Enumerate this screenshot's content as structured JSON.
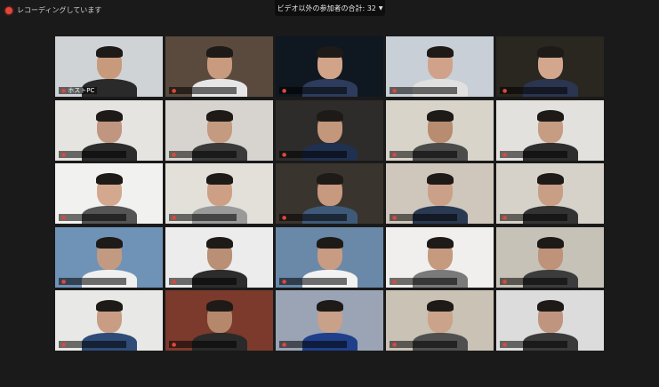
{
  "recording": {
    "label": "レコーディングしています"
  },
  "header": {
    "participants_label": "ビデオ以外の参加者の合計: 32"
  },
  "tiles": [
    {
      "wall": "#cfd3d6",
      "shirt": "#2a2a2a",
      "skin": "#c79a7c",
      "name": "ホストPC",
      "active": false
    },
    {
      "wall": "#5a4a3d",
      "shirt": "#e6e6e6",
      "skin": "#c89a7e",
      "name": "",
      "active": false
    },
    {
      "wall": "#0f1720",
      "shirt": "#2d3c5c",
      "skin": "#d1a48a",
      "name": "",
      "active": false
    },
    {
      "wall": "#c8cfd6",
      "shirt": "#e0e0e0",
      "skin": "#d0a28a",
      "name": "",
      "active": true
    },
    {
      "wall": "#2a2620",
      "shirt": "#2b3550",
      "skin": "#d2a78d",
      "name": "",
      "active": false
    },
    {
      "wall": "#e5e4e0",
      "shirt": "#2c2c2c",
      "skin": "#c09680",
      "name": "",
      "active": false
    },
    {
      "wall": "#d7d4cf",
      "shirt": "#3a3a3a",
      "skin": "#c49a80",
      "name": "",
      "active": false
    },
    {
      "wall": "#2e2c2a",
      "shirt": "#203050",
      "skin": "#c2977c",
      "name": "",
      "active": false
    },
    {
      "wall": "#d9d4c9",
      "shirt": "#4b4b4b",
      "skin": "#b88c70",
      "name": "",
      "active": false
    },
    {
      "wall": "#e2e1dd",
      "shirt": "#2e2e2e",
      "skin": "#c69c82",
      "name": "",
      "active": false
    },
    {
      "wall": "#f1f1ef",
      "shirt": "#555555",
      "skin": "#d4a88e",
      "name": "",
      "active": false
    },
    {
      "wall": "#e3e0da",
      "shirt": "#9a9a9a",
      "skin": "#cda086",
      "name": "",
      "active": false
    },
    {
      "wall": "#3a342e",
      "shirt": "#3f5a78",
      "skin": "#c7997f",
      "name": "",
      "active": false
    },
    {
      "wall": "#cfc7bb",
      "shirt": "#2a3a52",
      "skin": "#caa088",
      "name": "",
      "active": false
    },
    {
      "wall": "#d6d2ca",
      "shirt": "#333333",
      "skin": "#c89e84",
      "name": "",
      "active": false
    },
    {
      "wall": "#6f93b6",
      "shirt": "#f0f0f0",
      "skin": "#c29a82",
      "name": "",
      "active": false
    },
    {
      "wall": "#ececec",
      "shirt": "#2c2c2c",
      "skin": "#b98f75",
      "name": "",
      "active": false
    },
    {
      "wall": "#6a88a8",
      "shirt": "#f2f2f2",
      "skin": "#c79c82",
      "name": "",
      "active": false
    },
    {
      "wall": "#f0efed",
      "shirt": "#7a7a7a",
      "skin": "#c59a7f",
      "name": "",
      "active": false
    },
    {
      "wall": "#c7c2b8",
      "shirt": "#3c3c3c",
      "skin": "#bf9379",
      "name": "",
      "active": false
    },
    {
      "wall": "#e8e8e6",
      "shirt": "#2f4c78",
      "skin": "#c99d84",
      "name": "",
      "active": false
    },
    {
      "wall": "#7b3a2c",
      "shirt": "#2a2a2a",
      "skin": "#b5886c",
      "name": "",
      "active": false
    },
    {
      "wall": "#9aa4b5",
      "shirt": "#1f3f8a",
      "skin": "#c9a088",
      "name": "",
      "active": false
    },
    {
      "wall": "#c9c2b5",
      "shirt": "#4f4f4f",
      "skin": "#cba38a",
      "name": "",
      "active": false
    },
    {
      "wall": "#dcdcdc",
      "shirt": "#3a3a3a",
      "skin": "#c09580",
      "name": "",
      "active": false
    }
  ]
}
